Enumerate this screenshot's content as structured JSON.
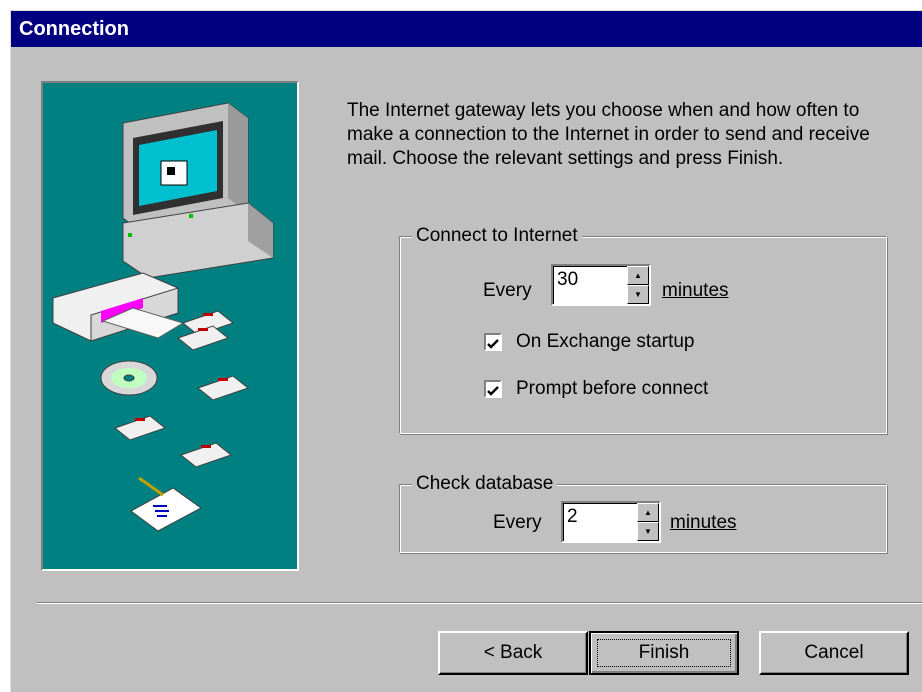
{
  "window": {
    "title": "Connection"
  },
  "description": "The Internet gateway lets you choose when and how often to make a connection to the Internet in order to send and receive mail. Choose the relevant settings and press Finish.",
  "connect_group": {
    "legend": "Connect to Internet",
    "every_label": "Every",
    "interval_value": "30",
    "units_label": "minutes",
    "startup_checkbox": {
      "label": "On Exchange startup",
      "checked": true
    },
    "prompt_checkbox": {
      "label": "Prompt before connect",
      "checked": true
    }
  },
  "database_group": {
    "legend": "Check database",
    "every_label": "Every",
    "interval_value": "2",
    "units_label": "minutes"
  },
  "buttons": {
    "back": "< Back",
    "finish": "Finish",
    "cancel": "Cancel"
  },
  "colors": {
    "titlebar": "#000080",
    "dialog_face": "#c0c0c0",
    "illustration_bg": "#008080"
  }
}
